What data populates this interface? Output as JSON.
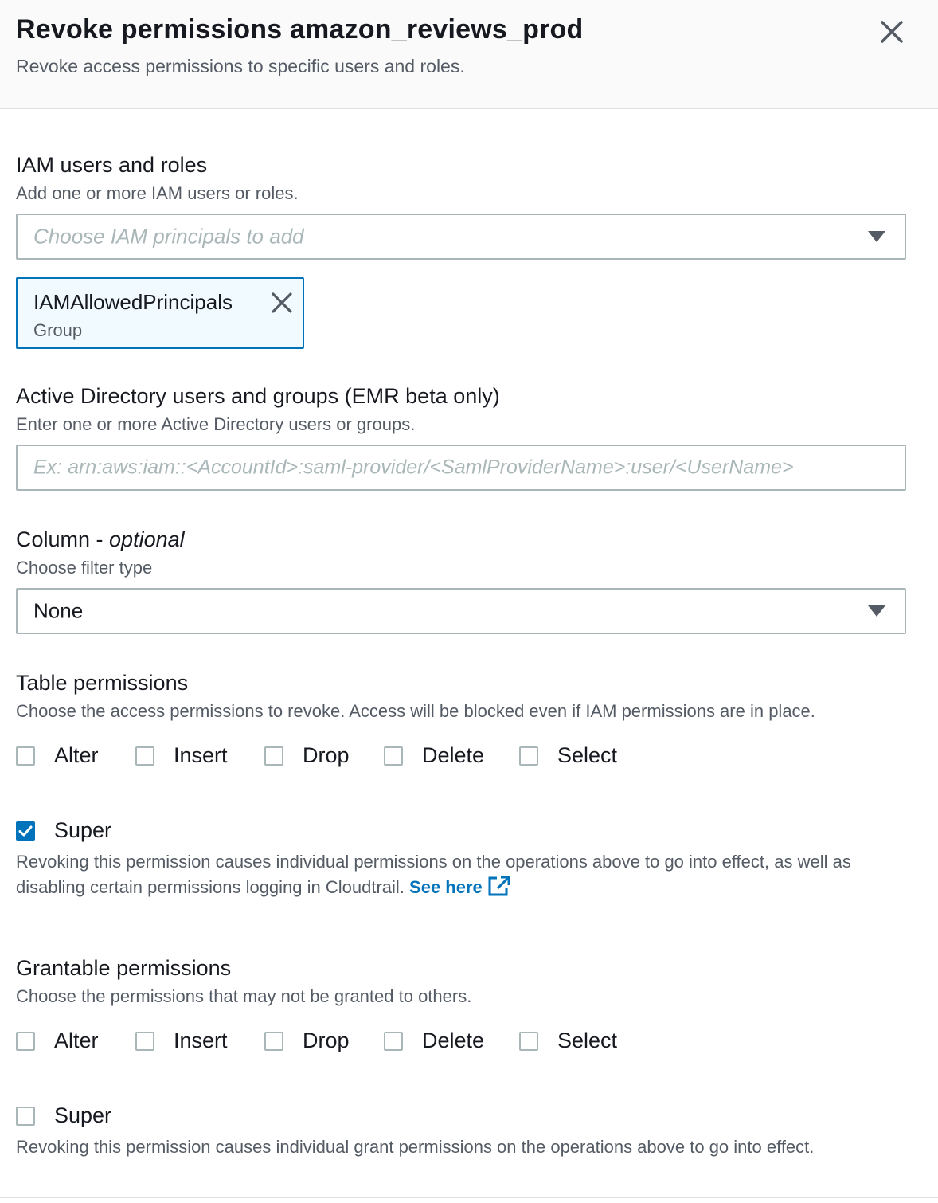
{
  "header": {
    "title": "Revoke permissions amazon_reviews_prod",
    "subtitle": "Revoke access permissions to specific users and roles."
  },
  "iam": {
    "label": "IAM users and roles",
    "description": "Add one or more IAM users or roles.",
    "placeholder": "Choose IAM principals to add",
    "selected": [
      {
        "name": "IAMAllowedPrincipals",
        "type": "Group"
      }
    ]
  },
  "active_directory": {
    "label": "Active Directory users and groups (EMR beta only)",
    "description": "Enter one or more Active Directory users or groups.",
    "placeholder": "Ex: arn:aws:iam::<AccountId>:saml-provider/<SamlProviderName>:user/<UserName>"
  },
  "column": {
    "label": "Column - ",
    "label_optional": "optional",
    "description": "Choose filter type",
    "value": "None"
  },
  "table_permissions": {
    "label": "Table permissions",
    "description": "Choose the access permissions to revoke. Access will be blocked even if IAM permissions are in place.",
    "options": [
      {
        "label": "Alter",
        "checked": false
      },
      {
        "label": "Insert",
        "checked": false
      },
      {
        "label": "Drop",
        "checked": false
      },
      {
        "label": "Delete",
        "checked": false
      },
      {
        "label": "Select",
        "checked": false
      }
    ],
    "super": {
      "label": "Super",
      "checked": true
    },
    "super_help": "Revoking this permission causes individual permissions on the operations above to go into effect, as well as disabling certain permissions logging in Cloudtrail.",
    "super_link": "See here"
  },
  "grantable_permissions": {
    "label": "Grantable permissions",
    "description": "Choose the permissions that may not be granted to others.",
    "options": [
      {
        "label": "Alter",
        "checked": false
      },
      {
        "label": "Insert",
        "checked": false
      },
      {
        "label": "Drop",
        "checked": false
      },
      {
        "label": "Delete",
        "checked": false
      },
      {
        "label": "Select",
        "checked": false
      }
    ],
    "super": {
      "label": "Super",
      "checked": false
    },
    "super_help": "Revoking this permission causes individual grant permissions on the operations above to go into effect."
  },
  "colors": {
    "accent": "#0073bb",
    "text": "#16191f",
    "secondary_text": "#545b64",
    "border": "#aab7b8"
  },
  "icons": {
    "close": "close-icon",
    "dropdown": "caret-down-icon",
    "remove_token": "remove-token-icon",
    "external_link": "external-link-icon"
  }
}
